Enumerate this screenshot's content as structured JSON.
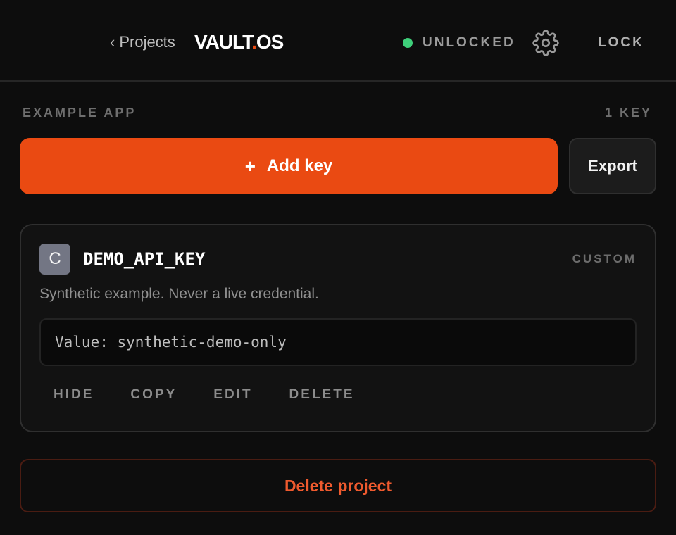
{
  "header": {
    "back_chevron": "‹",
    "back_label": "Projects",
    "brand_a": "VAULT",
    "brand_dot": ".",
    "brand_b": "OS",
    "status": "UNLOCKED",
    "settings_icon": "gear-icon",
    "lock_label": "LOCK"
  },
  "project": {
    "name": "EXAMPLE APP",
    "key_count": "1 KEY",
    "add_plus": "+",
    "add_label": "Add key",
    "export_label": "Export",
    "delete_label": "Delete project"
  },
  "key": {
    "avatar": "C",
    "name": "DEMO_API_KEY",
    "type": "CUSTOM",
    "description": "Synthetic example. Never a live credential.",
    "value": "Value: synthetic-demo-only",
    "actions": {
      "hide": "HIDE",
      "copy": "COPY",
      "edit": "EDIT",
      "delete": "DELETE"
    }
  },
  "colors": {
    "accent": "#ea4a12",
    "status_ok": "#3ecf7a",
    "danger": "#ef5a2e"
  }
}
